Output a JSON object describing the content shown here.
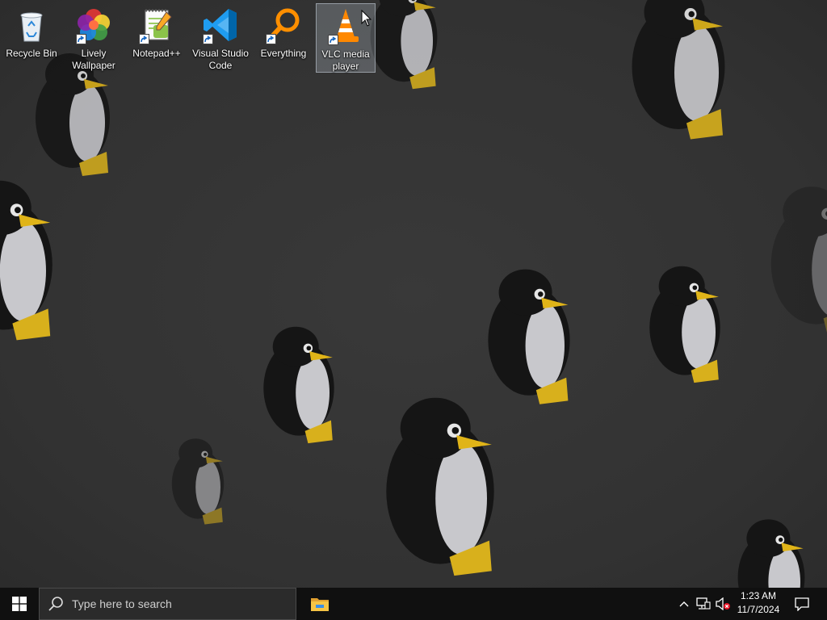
{
  "desktop": {
    "wallpaper": "penguin-wallpaper",
    "icons": [
      {
        "label": "Recycle Bin",
        "icon": "recycle-bin-icon"
      },
      {
        "label": "Lively Wallpaper",
        "icon": "lively-wallpaper-icon"
      },
      {
        "label": "Notepad++",
        "icon": "notepad-plus-plus-icon"
      },
      {
        "label": "Visual Studio Code",
        "icon": "vscode-icon"
      },
      {
        "label": "Everything",
        "icon": "everything-search-icon"
      },
      {
        "label": "VLC media player",
        "icon": "vlc-icon",
        "selected": true
      }
    ]
  },
  "taskbar": {
    "search_placeholder": "Type here to search",
    "pinned_apps": [
      {
        "icon": "file-explorer-icon"
      }
    ],
    "tray_icons": [
      "chevron-up-icon",
      "network-icon",
      "volume-muted-icon"
    ],
    "clock": {
      "time": "1:23 AM",
      "date": "11/7/2024"
    },
    "colors": {
      "taskbar": "#101010",
      "search_box": "#2b2b2b",
      "accent": "#0078d7"
    }
  }
}
